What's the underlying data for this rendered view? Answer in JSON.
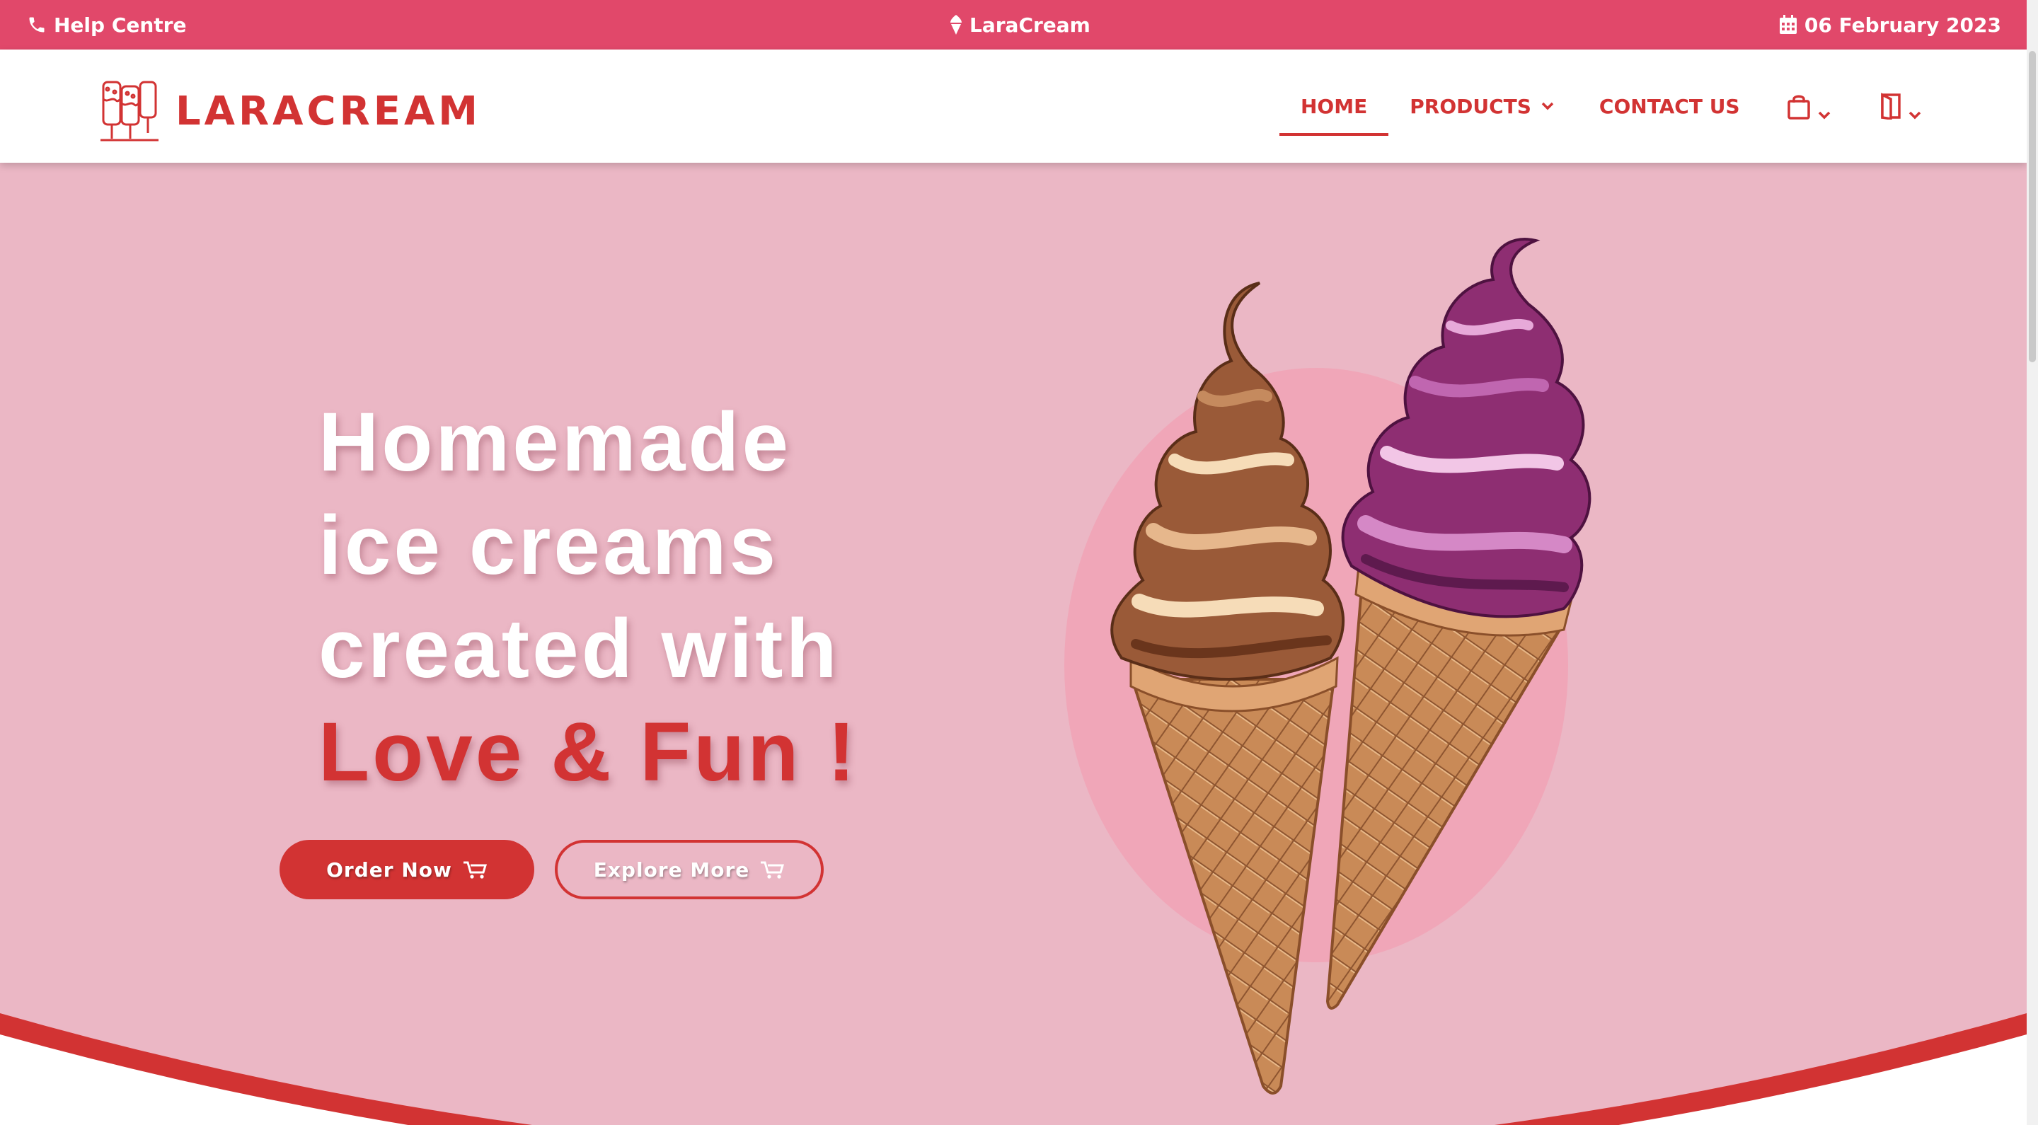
{
  "topbar": {
    "help_label": "Help Centre",
    "help_icon": "phone-icon",
    "site_name": "LaraCream",
    "site_icon": "ice-cream-icon",
    "date_label": "06 February 2023",
    "date_icon": "calendar-icon",
    "bg_color": "#e1486a"
  },
  "header": {
    "brand": "LARACREAM",
    "logo_icon": "ice-cream-shop-icon",
    "nav": {
      "home": "HOME",
      "products": "PRODUCTS",
      "contact": "CONTACT US",
      "cart_icon": "shopping-bag-icon",
      "user_icon": "door-icon",
      "active": "HOME"
    }
  },
  "hero": {
    "headline_line1": "Homemade",
    "headline_line2": "ice creams",
    "headline_line3": "created with",
    "headline_accent": "Love & Fun !",
    "order_button": "Order Now",
    "explore_button": "Explore More",
    "button_icon": "cart-icon",
    "bg_color": "#ebb7c5",
    "accent_color": "#d23333"
  }
}
